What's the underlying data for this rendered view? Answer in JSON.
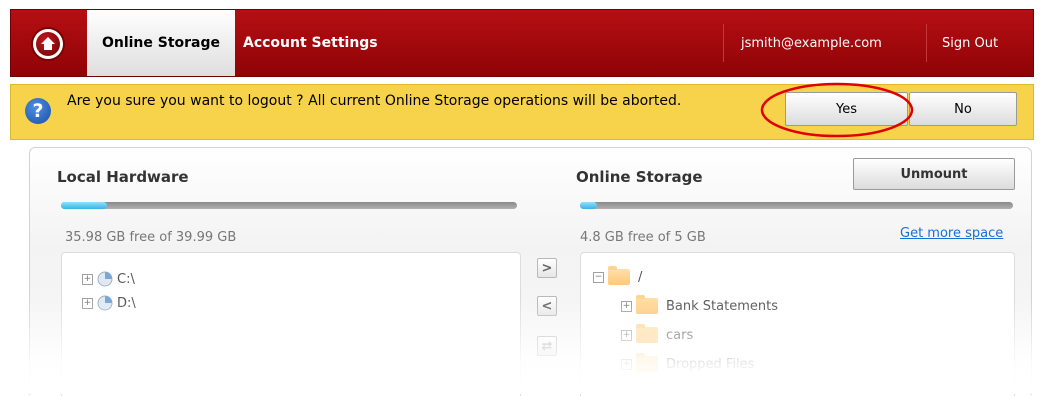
{
  "header": {
    "tab_active": "Online Storage",
    "tab_account": "Account Settings",
    "user_email": "jsmith@example.com",
    "sign_out": "Sign Out"
  },
  "notice": {
    "message": "Are you sure you want to logout ? All current Online Storage operations will be aborted.",
    "yes": "Yes",
    "no": "No"
  },
  "local": {
    "title": "Local Hardware",
    "free_text": "35.98 GB free of 39.99 GB",
    "usage_fraction": 0.1,
    "drives": [
      "C:\\",
      "D:\\"
    ]
  },
  "online": {
    "title": "Online Storage",
    "unmount": "Unmount",
    "free_text": "4.8 GB free of 5 GB",
    "more_space": "Get more space",
    "usage_fraction": 0.04,
    "root": "/",
    "folders": [
      "Bank Statements",
      "cars",
      "Dropped Files"
    ]
  },
  "colors": {
    "header_red": "#a8080c",
    "notice_yellow": "#f7d34c",
    "highlight_red": "#e00000",
    "link_blue": "#1a6fd6"
  },
  "icons": [
    "home-icon",
    "question-icon",
    "drive-icon",
    "folder-icon",
    "arrow-right-icon",
    "arrow-left-icon",
    "sync-icon"
  ]
}
